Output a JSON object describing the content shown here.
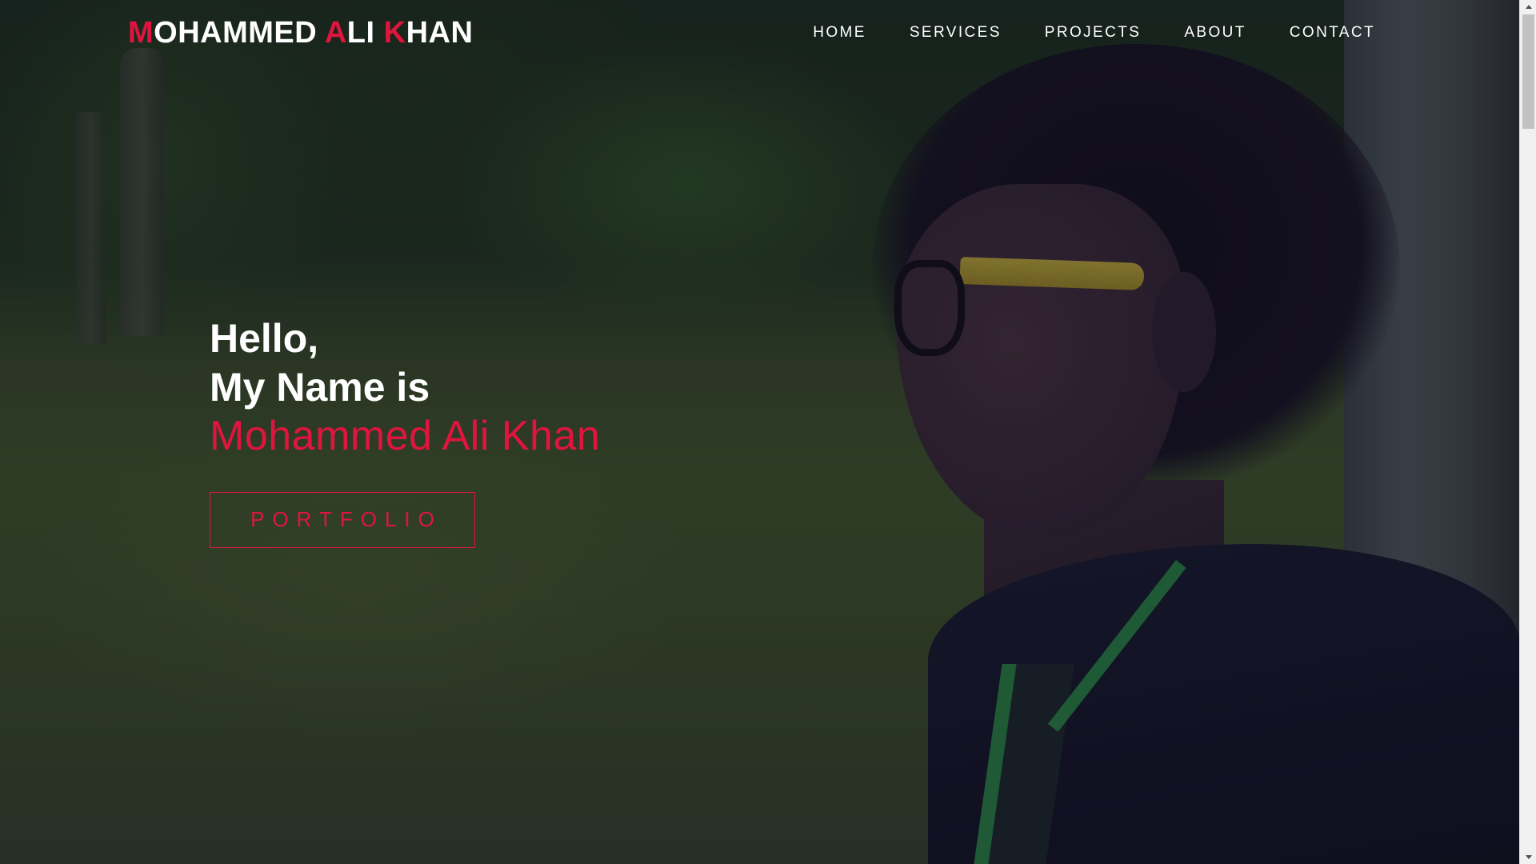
{
  "header": {
    "logo": {
      "first_initial": "M",
      "first_rest": "OHAMMED ",
      "middle_initial": "A",
      "middle_rest": "LI ",
      "last_initial": "K",
      "last_rest": "HAN"
    },
    "nav": [
      {
        "label": "HOME"
      },
      {
        "label": "SERVICES"
      },
      {
        "label": "PROJECTS"
      },
      {
        "label": "ABOUT"
      },
      {
        "label": "CONTACT"
      }
    ]
  },
  "hero": {
    "greeting": "Hello,",
    "intro": "My Name is",
    "name": "Mohammed Ali Khan",
    "button_label": "PORTFOLIO"
  },
  "colors": {
    "accent": "#e0153e",
    "text": "#ffffff",
    "overlay": "#161222"
  },
  "icons": {
    "scroll_up": "triangle-up-icon",
    "scroll_down": "triangle-down-icon"
  }
}
